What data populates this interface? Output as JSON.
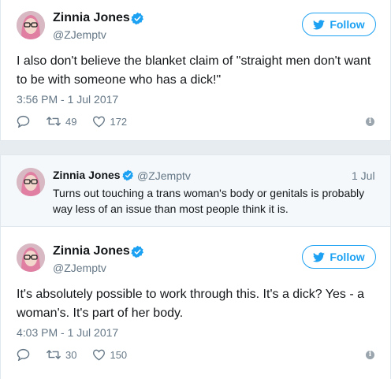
{
  "tweet1": {
    "name": "Zinnia Jones",
    "handle": "@ZJemptv",
    "follow_label": "Follow",
    "text_line1": "I also don't believe the blanket claim of \"straight men don't want",
    "text_line2": "to be with someone who has a dick!\"",
    "timestamp": "3:56 PM - 1 Jul 2017",
    "retweets": "49",
    "likes": "172"
  },
  "quoted": {
    "name": "Zinnia Jones",
    "handle": "@ZJemptv",
    "date": "1 Jul",
    "text_line1": "Turns out touching a trans woman's body or genitals is probably",
    "text_line2": "way less of an issue than most people think it is."
  },
  "tweet2": {
    "name": "Zinnia Jones",
    "handle": "@ZJemptv",
    "follow_label": "Follow",
    "text_line1": "It's absolutely possible to work through this. It's a dick? Yes - a",
    "text_line2": "woman's. It's part of her body.",
    "timestamp": "4:03 PM - 1 Jul 2017",
    "retweets": "30",
    "likes": "150"
  },
  "colors": {
    "twitter_blue": "#1da1f2",
    "secondary_text": "#657786",
    "background": "#e6ecf0"
  },
  "icons": [
    "verified-badge-icon",
    "twitter-bird-icon",
    "reply-icon",
    "retweet-icon",
    "heart-icon",
    "info-icon"
  ]
}
